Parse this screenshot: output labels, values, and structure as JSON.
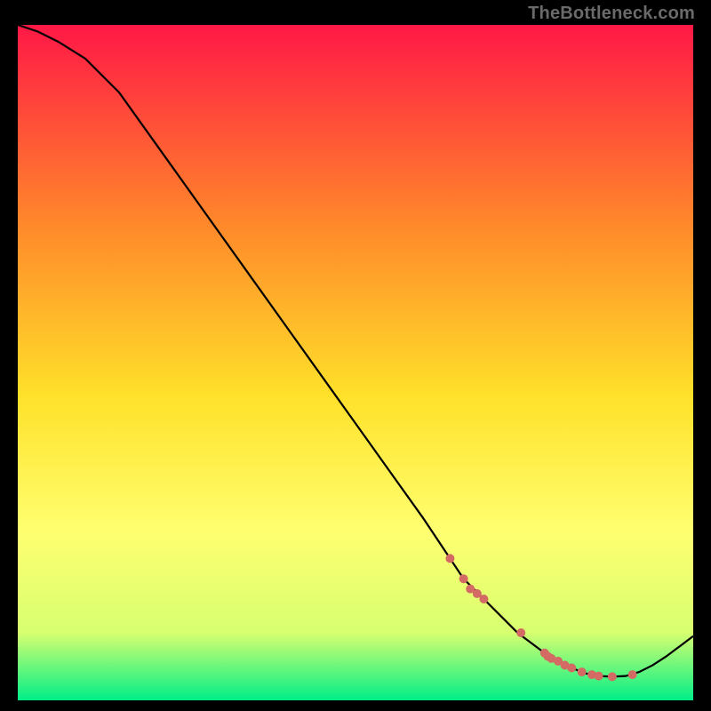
{
  "watermark": "TheBottleneck.com",
  "chart_data": {
    "type": "line",
    "title": "",
    "xlabel": "",
    "ylabel": "",
    "xlim": [
      0,
      100
    ],
    "ylim": [
      0,
      100
    ],
    "grid": false,
    "legend": false,
    "background_gradient": {
      "top": "#ff1846",
      "upper_mid": "#ff8a2a",
      "mid": "#ffe12a",
      "lower_mid": "#ffff70",
      "near_bottom": "#d7ff70",
      "bottom": "#00ee88"
    },
    "series": [
      {
        "name": "bottleneck-curve",
        "color": "#000000",
        "x": [
          0,
          3,
          6,
          10,
          15,
          20,
          25,
          30,
          35,
          40,
          45,
          50,
          55,
          60,
          64,
          66,
          69,
          72,
          74,
          76,
          78,
          80,
          82,
          84,
          86,
          88,
          90,
          92,
          94,
          96,
          98,
          100
        ],
        "y": [
          100,
          99,
          97.5,
          95,
          90,
          83,
          76,
          69,
          62,
          55,
          48,
          41,
          34,
          27,
          21,
          18,
          15,
          12,
          10,
          8.5,
          7,
          5.8,
          4.8,
          4,
          3.6,
          3.5,
          3.6,
          4.2,
          5.2,
          6.5,
          8,
          9.5
        ]
      }
    ],
    "markers": {
      "name": "highlight-points",
      "color": "#d46a64",
      "radius": 5,
      "points": [
        {
          "x": 64,
          "y": 21
        },
        {
          "x": 66,
          "y": 18
        },
        {
          "x": 67,
          "y": 16.5
        },
        {
          "x": 68,
          "y": 15.8
        },
        {
          "x": 69,
          "y": 15
        },
        {
          "x": 74.5,
          "y": 10
        },
        {
          "x": 78,
          "y": 7
        },
        {
          "x": 78.5,
          "y": 6.5
        },
        {
          "x": 79,
          "y": 6.2
        },
        {
          "x": 80,
          "y": 5.8
        },
        {
          "x": 81,
          "y": 5.2
        },
        {
          "x": 82,
          "y": 4.8
        },
        {
          "x": 83.5,
          "y": 4.2
        },
        {
          "x": 85,
          "y": 3.8
        },
        {
          "x": 86,
          "y": 3.6
        },
        {
          "x": 88,
          "y": 3.5
        },
        {
          "x": 91,
          "y": 3.8
        }
      ]
    }
  }
}
